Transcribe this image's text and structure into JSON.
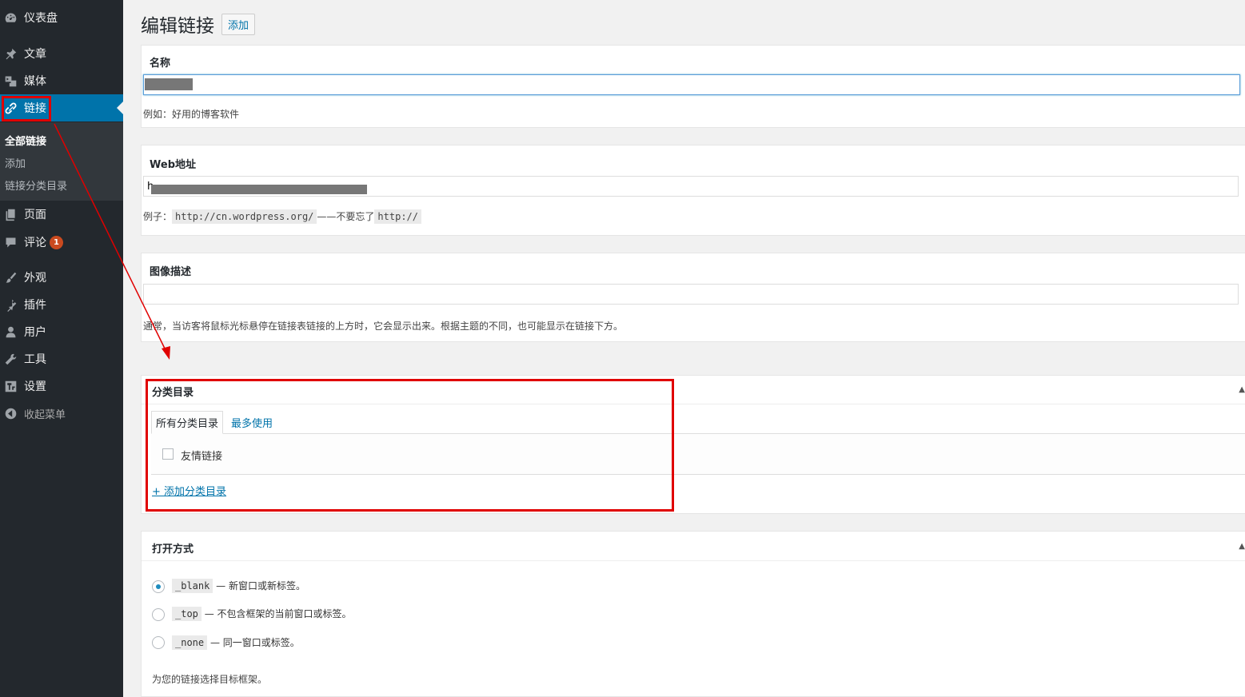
{
  "sidebar": {
    "items": [
      {
        "label": "仪表盘",
        "icon": "dashboard-icon"
      },
      {
        "label": "文章",
        "icon": "pin-icon"
      },
      {
        "label": "媒体",
        "icon": "media-icon"
      },
      {
        "label": "链接",
        "icon": "link-icon",
        "active": true
      },
      {
        "label": "页面",
        "icon": "page-icon"
      },
      {
        "label": "评论",
        "icon": "comment-icon",
        "badge": "1"
      },
      {
        "label": "外观",
        "icon": "brush-icon"
      },
      {
        "label": "插件",
        "icon": "plugin-icon"
      },
      {
        "label": "用户",
        "icon": "user-icon"
      },
      {
        "label": "工具",
        "icon": "wrench-icon"
      },
      {
        "label": "设置",
        "icon": "settings-icon"
      },
      {
        "label": "收起菜单",
        "icon": "collapse-icon"
      }
    ],
    "submenu": [
      "全部链接",
      "添加",
      "链接分类目录"
    ]
  },
  "header": {
    "title": "编辑链接",
    "add_label": "添加"
  },
  "name_box": {
    "title": "名称",
    "value": "",
    "desc": "例如：好用的博客软件"
  },
  "url_box": {
    "title": "Web地址",
    "value": "h",
    "desc_prefix": "例子：",
    "example_url": "http://cn.wordpress.org/",
    "desc_middle": "——不要忘了",
    "example_proto": "http://"
  },
  "image_box": {
    "title": "图像描述",
    "value": "",
    "desc": "通常，当访客将鼠标光标悬停在链接表链接的上方时，它会显示出来。根据主题的不同，也可能显示在链接下方。"
  },
  "category_box": {
    "title": "分类目录",
    "tab_all": "所有分类目录",
    "tab_popular": "最多使用",
    "categories": [
      {
        "label": "友情链接",
        "checked": false
      }
    ],
    "add_link": "+ 添加分类目录"
  },
  "target_box": {
    "title": "打开方式",
    "options": [
      {
        "code": "_blank",
        "text": " — 新窗口或新标签。",
        "checked": true
      },
      {
        "code": "_top",
        "text": " — 不包含框架的当前窗口或标签。",
        "checked": false
      },
      {
        "code": "_none",
        "text": " — 同一窗口或标签。",
        "checked": false
      }
    ],
    "desc": "为您的链接选择目标框架。"
  },
  "colors": {
    "accent": "#0073aa",
    "sidebar": "#23282d",
    "annotation": "#e00000"
  }
}
